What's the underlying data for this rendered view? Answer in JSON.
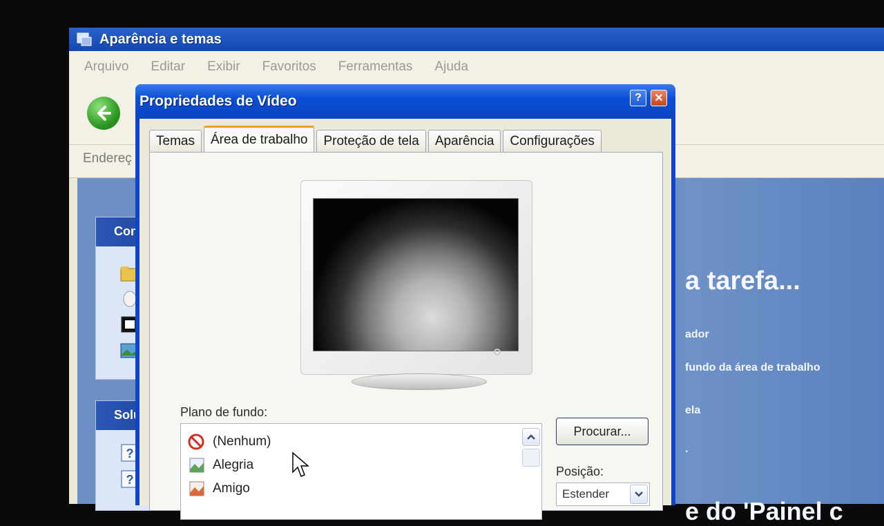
{
  "background_window": {
    "title": "Aparência e temas",
    "menu": [
      "Arquivo",
      "Editar",
      "Exibir",
      "Favoritos",
      "Ferramentas",
      "Ajuda"
    ],
    "address_label": "Endereç",
    "sidebar_box1_header": "Con",
    "sidebar_box2_header": "Solu",
    "right_pane": {
      "heading": "a tarefa...",
      "links": [
        "ador",
        "fundo da área de trabalho",
        "ela",
        "."
      ],
      "footer": "e do 'Painel c"
    }
  },
  "dialog": {
    "title": "Propriedades de Vídeo",
    "help_label": "?",
    "close_label": "✕",
    "tabs": [
      {
        "label": "Temas",
        "active": false
      },
      {
        "label": "Área de trabalho",
        "active": true
      },
      {
        "label": "Proteção de tela",
        "active": false
      },
      {
        "label": "Aparência",
        "active": false
      },
      {
        "label": "Configurações",
        "active": false
      }
    ],
    "background_label": "Plano de fundo:",
    "background_items": [
      {
        "label": "(Nenhum)",
        "icon": "no-entry-icon"
      },
      {
        "label": "Alegria",
        "icon": "image-file-icon"
      },
      {
        "label": "Amigo",
        "icon": "image-file-icon"
      }
    ],
    "browse_button": "Procurar...",
    "position_label": "Posição:",
    "position_value": "Estender"
  },
  "colors": {
    "xp_title_blue": "#0b4fd6",
    "dialog_face": "#ece9d8",
    "active_tab_accent": "#f0a020",
    "back_button_green": "#2e9a23",
    "close_button_red": "#c8451e"
  }
}
